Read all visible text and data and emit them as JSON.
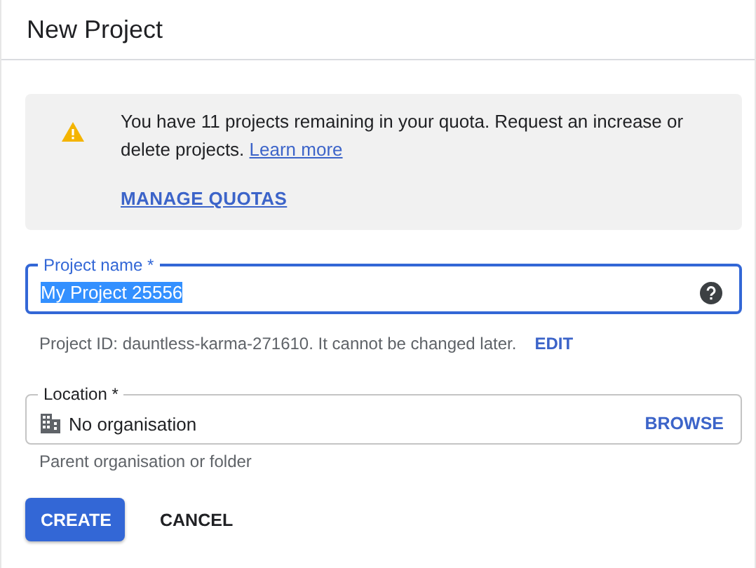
{
  "dialog": {
    "title": "New Project"
  },
  "notice": {
    "text": "You have 11 projects remaining in your quota. Request an increase or delete projects.",
    "link": "Learn more",
    "action": "MANAGE QUOTAS"
  },
  "project_name": {
    "label": "Project name *",
    "value": "My Project 25556",
    "focused": true,
    "value_selected": true
  },
  "project_id": {
    "text": "Project ID: dauntless-karma-271610. It cannot be changed later.",
    "action": "EDIT"
  },
  "location": {
    "label": "Location *",
    "value": "No organisation",
    "action": "BROWSE",
    "helper": "Parent organisation or folder"
  },
  "buttons": [
    {
      "label": "CREATE",
      "kind": "primary"
    },
    {
      "label": "CANCEL",
      "kind": "text"
    }
  ]
}
